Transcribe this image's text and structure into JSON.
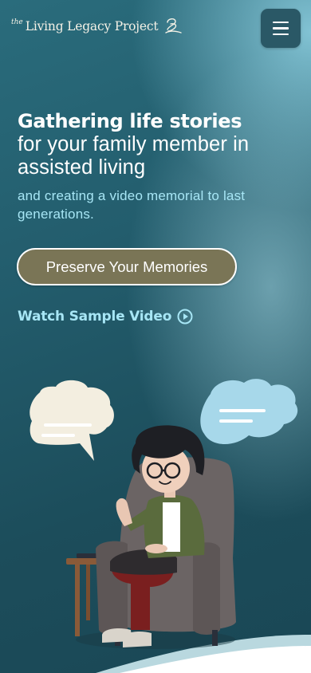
{
  "header": {
    "logo_prefix": "the",
    "logo_name": "Living Legacy Project",
    "menu_icon": "hamburger-icon"
  },
  "hero": {
    "headline_bold": "Gathering life stories",
    "headline_light_1": "for your family member in",
    "headline_light_2": "assisted living",
    "subheadline": "and creating a video memorial to last generations."
  },
  "cta": {
    "primary_label": "Preserve Your Memories",
    "secondary_label": "Watch Sample Video",
    "secondary_icon": "play-circle-icon"
  },
  "colors": {
    "background": "#235d6d",
    "accent_light": "#a7e6f5",
    "button": "#7a7556",
    "menu_button": "#2a5866"
  }
}
